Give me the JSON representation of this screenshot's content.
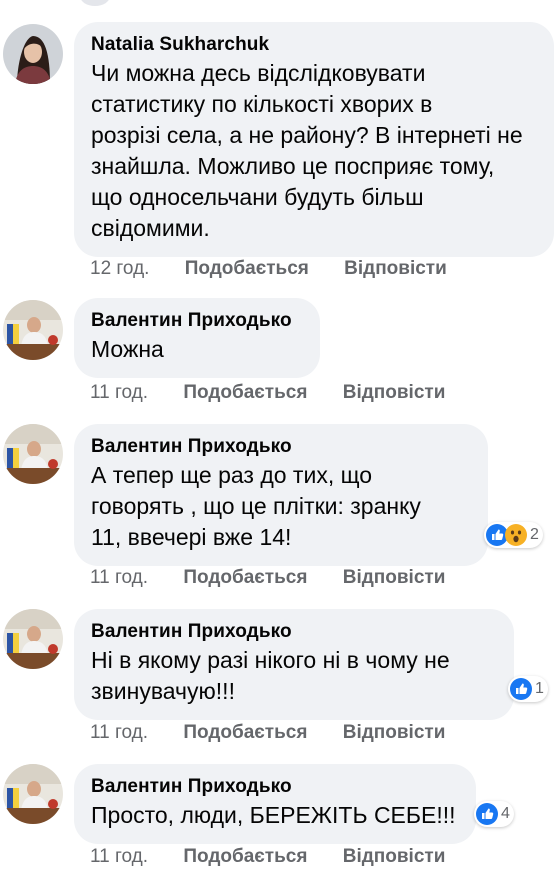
{
  "actions": {
    "like_label": "Подобається",
    "reply_label": "Відповісти"
  },
  "comments": [
    {
      "author": "Natalia Sukharchuk",
      "lines": [
        "Чи можна десь відслідковувати",
        "статистику по кількості хворих в",
        "розрізі села, а не району? В інтернеті не",
        "знайшла. Можливо це посприяє тому,",
        "що односельчани будуть більш",
        "свідомими."
      ],
      "time": "12 год.",
      "avatar": "woman-portrait-avatar"
    },
    {
      "author": "Валентин Приходько",
      "lines": [
        "Можна"
      ],
      "time": "11 год.",
      "avatar": "man-at-desk-avatar"
    },
    {
      "author": "Валентин Приходько",
      "lines": [
        "А тепер ще раз до тих, що",
        "говорять , що це плітки: зранку",
        "11, ввечері вже 14!"
      ],
      "time": "11 год.",
      "avatar": "man-at-desk-avatar",
      "reactions": {
        "icons": [
          "like-reaction-icon",
          "wow-reaction-icon"
        ],
        "count": "2"
      }
    },
    {
      "author": "Валентин Приходько",
      "lines": [
        "Ні в якому разі нікого ні в чому не",
        "звинувачую!!!"
      ],
      "time": "11 год.",
      "avatar": "man-at-desk-avatar",
      "reactions": {
        "icons": [
          "like-reaction-icon"
        ],
        "count": "1"
      }
    },
    {
      "author": "Валентин Приходько",
      "lines": [
        "Просто, люди, БЕРЕЖІТЬ СЕБЕ!!!"
      ],
      "time": "11 год.",
      "avatar": "man-at-desk-avatar",
      "reactions": {
        "icons": [
          "like-reaction-icon"
        ],
        "count": "4"
      }
    }
  ],
  "colors": {
    "bubble": "#f0f2f5",
    "secondary_text": "#65676b",
    "like_blue": "#1877f2",
    "wow_yellow": "#f7b125"
  }
}
